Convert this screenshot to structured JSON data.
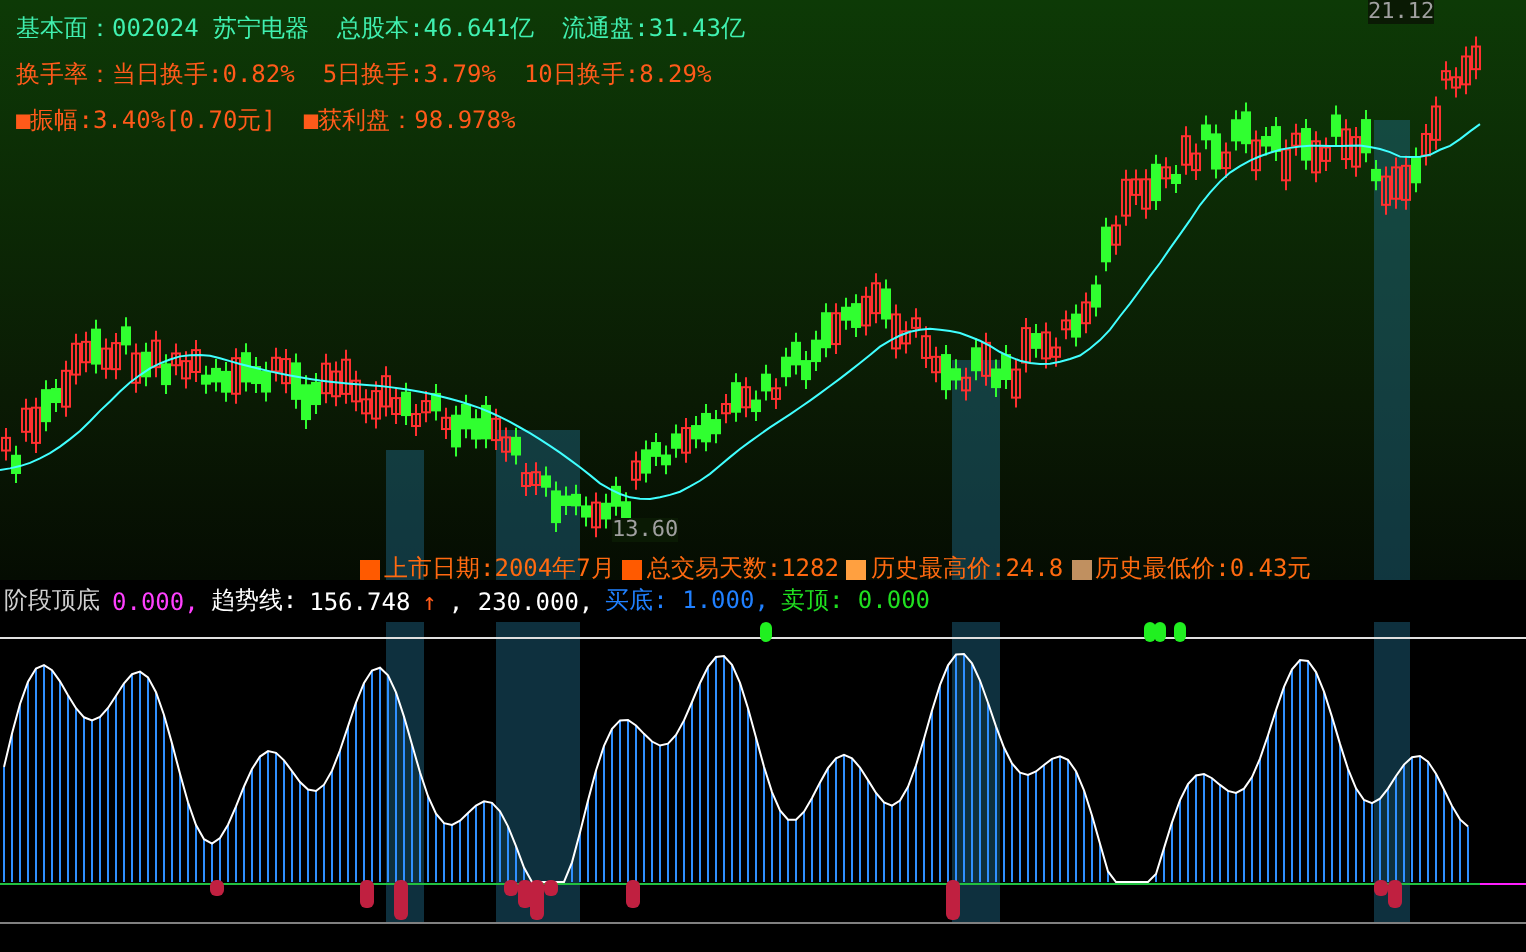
{
  "header": {
    "lines": [
      {
        "color": "#40f0b0",
        "items": [
          "基本面：002024 苏宁电器",
          "总股本:46.641亿",
          "流通盘:31.43亿"
        ]
      },
      {
        "color": "#ff5a1a",
        "items": [
          "换手率：当日换手:0.82%",
          "5日换手:3.79%",
          "10日换手:8.29%"
        ]
      },
      {
        "color": "#ff5a1a",
        "items": [
          "■振幅:3.40%[0.70元]",
          "■获利盘：98.978%"
        ]
      }
    ]
  },
  "price_labels": {
    "high": "21.12",
    "low": "13.60"
  },
  "info_bar": [
    {
      "color": "#ff5a00",
      "text": "上市日期:2004年7月"
    },
    {
      "color": "#ff5a00",
      "text": "总交易天数:1282"
    },
    {
      "color": "#ffa040",
      "text": "历史最高价:24.8"
    },
    {
      "color": "#c09060",
      "text": "历史最低价:0.43元"
    }
  ],
  "indicator_legend": [
    {
      "color": "#d0d0d0",
      "text": "阶段顶底"
    },
    {
      "color": "#ff40ff",
      "text": "0.000,"
    },
    {
      "color": "#ffffff",
      "text": "趋势线:"
    },
    {
      "color": "#ffffff",
      "text": "156.748"
    },
    {
      "color": "#ff5a1a",
      "text": "↑"
    },
    {
      "color": "#ffffff",
      "text": ", 230.000,"
    },
    {
      "color": "#2080ff",
      "text": "买底: 1.000,"
    },
    {
      "color": "#20e020",
      "text": "卖顶: 0.000"
    }
  ]
}
